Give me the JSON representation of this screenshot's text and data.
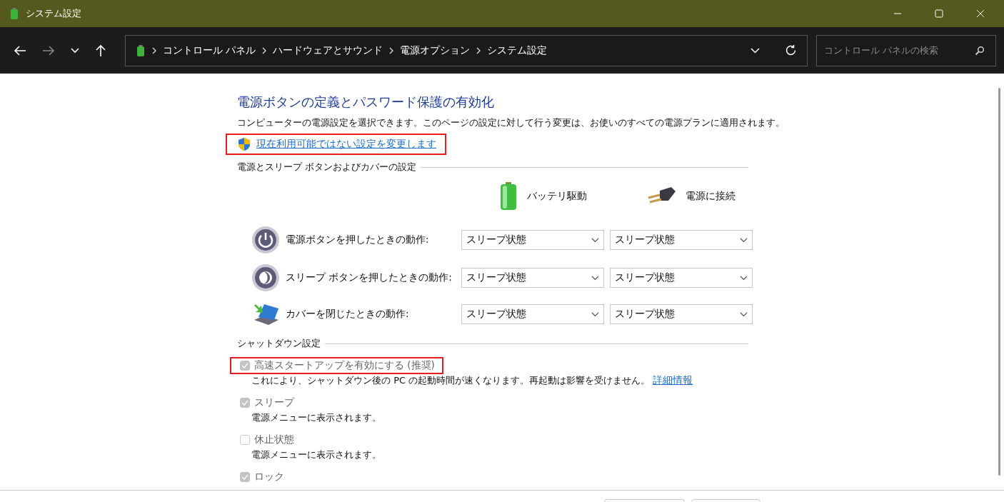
{
  "window": {
    "title": "システム設定"
  },
  "address_bar": {
    "breadcrumbs": [
      "コントロール パネル",
      "ハードウェアとサウンド",
      "電源オプション",
      "システム設定"
    ]
  },
  "search": {
    "placeholder": "コントロール パネルの検索"
  },
  "page": {
    "heading": "電源ボタンの定義とパスワード保護の有効化",
    "description": "コンピューターの電源設定を選択できます。このページの設定に対して行う変更は、お使いのすべての電源プランに適用されます。",
    "admin_link": {
      "label": "現在利用可能ではない設定を変更します",
      "highlighted": true
    }
  },
  "power_section": {
    "title": "電源とスリープ ボタンおよびカバーの設定",
    "columns": [
      {
        "label": "バッテリ駆動",
        "kind": "battery"
      },
      {
        "label": "電源に接続",
        "kind": "plug"
      }
    ],
    "rows": [
      {
        "kind": "power",
        "label": "電源ボタンを押したときの動作:",
        "values": [
          "スリープ状態",
          "スリープ状態"
        ]
      },
      {
        "kind": "sleep",
        "label": "スリープ ボタンを押したときの動作:",
        "values": [
          "スリープ状態",
          "スリープ状態"
        ]
      },
      {
        "kind": "lid",
        "label": "カバーを閉じたときの動作:",
        "values": [
          "スリープ状態",
          "スリープ状態"
        ]
      }
    ]
  },
  "shutdown_section": {
    "title": "シャットダウン設定",
    "options": [
      {
        "label": "高速スタートアップを有効にする (推奨)",
        "checked": true,
        "disabled": true,
        "highlighted": true,
        "description": "これにより、シャットダウン後の PC の起動時間が速くなります。再起動は影響を受けません。",
        "link": "詳細情報"
      },
      {
        "label": "スリープ",
        "checked": true,
        "disabled": true,
        "highlighted": false,
        "description": "電源メニューに表示されます。"
      },
      {
        "label": "休止状態",
        "checked": false,
        "disabled": true,
        "highlighted": false,
        "description": "電源メニューに表示されます。"
      },
      {
        "label": "ロック",
        "checked": true,
        "disabled": true,
        "highlighted": false
      }
    ]
  }
}
